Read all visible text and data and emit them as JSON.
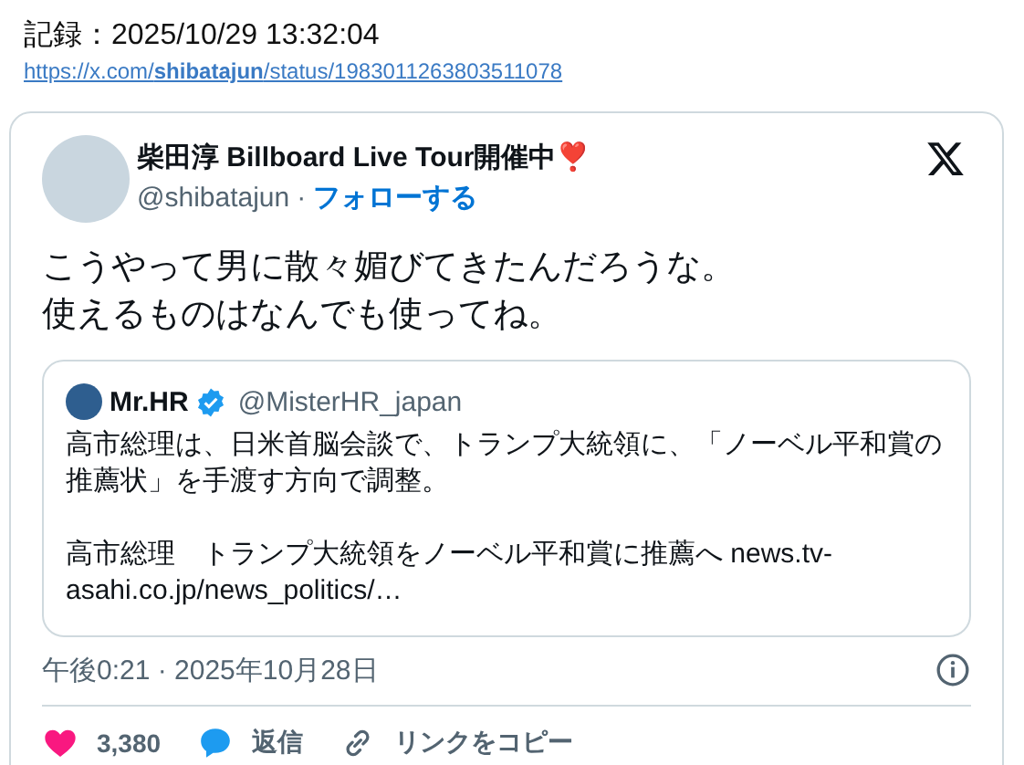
{
  "record": {
    "label": "記録：2025/10/29 13:32:04",
    "link": "https://x.com/**shibatajun**/status/1983011263803511078"
  },
  "tweet": {
    "author": {
      "name": "柴田淳 Billboard Live Tour開催中❣️",
      "handle": "@shibatajun",
      "separator": "·",
      "follow": "フォローする"
    },
    "text": [
      "こうやって男に散々媚びてきたんだろうな。",
      "使えるものはなんでも使ってね。"
    ],
    "quote": {
      "name": "Mr.HR",
      "verified": true,
      "handle": "@MisterHR_japan",
      "paragraphs": [
        "高市総理は、日米首脳会談で、トランプ大統領に、「ノーベル平和賞の推薦状」を手渡す方向で調整。",
        "高市総理　トランプ大統領をノーベル平和賞に推薦へ news.tv-asahi.co.jp/news_politics/…"
      ]
    },
    "timestamp": "午後0:21 · 2025年10月28日",
    "actions": [
      {
        "kind": "like",
        "label": "3,380"
      },
      {
        "kind": "reply",
        "label": "返信"
      },
      {
        "kind": "copy",
        "label": "リンクをコピー"
      }
    ]
  }
}
